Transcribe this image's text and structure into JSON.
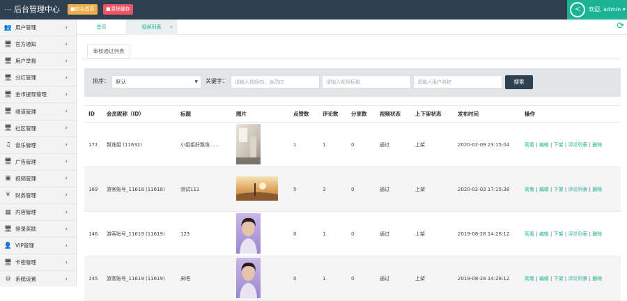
{
  "header": {
    "logo": "后台管理中心",
    "btn_home": "前台首页",
    "btn_cache": "清除缓存",
    "user": "欢迎, admin ▾"
  },
  "sidebar": {
    "items": [
      {
        "label": "用户管理",
        "icon": "users-icon",
        "glyph": "👥"
      },
      {
        "label": "官方通知",
        "icon": "monitor-icon",
        "glyph": "🖥"
      },
      {
        "label": "用户举报",
        "icon": "monitor-icon",
        "glyph": "🖥"
      },
      {
        "label": "分红管理",
        "icon": "monitor-icon",
        "glyph": "🖥"
      },
      {
        "label": "金币提现管理",
        "icon": "monitor-icon",
        "glyph": "🖥"
      },
      {
        "label": "频道管理",
        "icon": "monitor-icon",
        "glyph": "🖥"
      },
      {
        "label": "社区管理",
        "icon": "monitor-icon",
        "glyph": "🖥"
      },
      {
        "label": "音乐管理",
        "icon": "music-icon",
        "glyph": "♫"
      },
      {
        "label": "广告管理",
        "icon": "monitor-icon",
        "glyph": "🖥"
      },
      {
        "label": "视频管理",
        "icon": "video-icon",
        "glyph": "▣"
      },
      {
        "label": "财务管理",
        "icon": "yen-icon",
        "glyph": "¥"
      },
      {
        "label": "内容管理",
        "icon": "grid-icon",
        "glyph": "▦"
      },
      {
        "label": "登录奖励",
        "icon": "monitor-icon",
        "glyph": "🖥"
      },
      {
        "label": "VIP管理",
        "icon": "user-icon",
        "glyph": "👤"
      },
      {
        "label": "卡密管理",
        "icon": "monitor-icon",
        "glyph": "🖥"
      },
      {
        "label": "系统设置",
        "icon": "gears-icon",
        "glyph": "⚙"
      }
    ]
  },
  "tabs": {
    "home": "首页",
    "video": "视频列表"
  },
  "page": {
    "title": "审核通过列表"
  },
  "search": {
    "sort_label": "排序：",
    "sort_value": "默认",
    "keyword_label": "关键字：",
    "ph1": "请输入视频ID、会员ID",
    "ph2": "请输入视频标题",
    "ph3": "请输入用户名称",
    "button": "搜索"
  },
  "table": {
    "headers": [
      "ID",
      "会员昵称（ID）",
      "标题",
      "图片",
      "点赞数",
      "评论数",
      "分享数",
      "视频状态",
      "上下架状态",
      "发布时间",
      "操作"
    ],
    "ops": {
      "view": "观看",
      "edit": "编辑",
      "down": "下架",
      "comments": "评论列表",
      "delete": "删除",
      "sep": " | "
    },
    "rows": [
      {
        "id": "171",
        "member": "飘逸姐 (11632)",
        "title": "小姐姐好飘逸......",
        "likes": "1",
        "comments": "1",
        "shares": "0",
        "status": "通过",
        "shelf": "上架",
        "time": "2020-02-09 23:15:04",
        "img": "room"
      },
      {
        "id": "169",
        "member": "游客账号_11618 (11618)",
        "title": "测试111",
        "likes": "5",
        "comments": "3",
        "shares": "0",
        "status": "通过",
        "shelf": "上架",
        "time": "2020-02-03 17:15:38",
        "img": "sunset"
      },
      {
        "id": "146",
        "member": "游客账号_11619 (11619)",
        "title": "123",
        "likes": "0",
        "comments": "1",
        "shares": "0",
        "status": "通过",
        "shelf": "上架",
        "time": "2019-08-28 14:28:12",
        "img": "portrait"
      },
      {
        "id": "145",
        "member": "游客账号_11619 (11619)",
        "title": "来吧",
        "likes": "0",
        "comments": "1",
        "shares": "0",
        "status": "通过",
        "shelf": "上架",
        "time": "2019-08-28 14:28:12",
        "img": "portrait"
      }
    ]
  },
  "colors": {
    "topbar": "#2f4050",
    "accent": "#1ab394",
    "btn_home": "#f0ad4e",
    "btn_cache": "#ed5565"
  }
}
